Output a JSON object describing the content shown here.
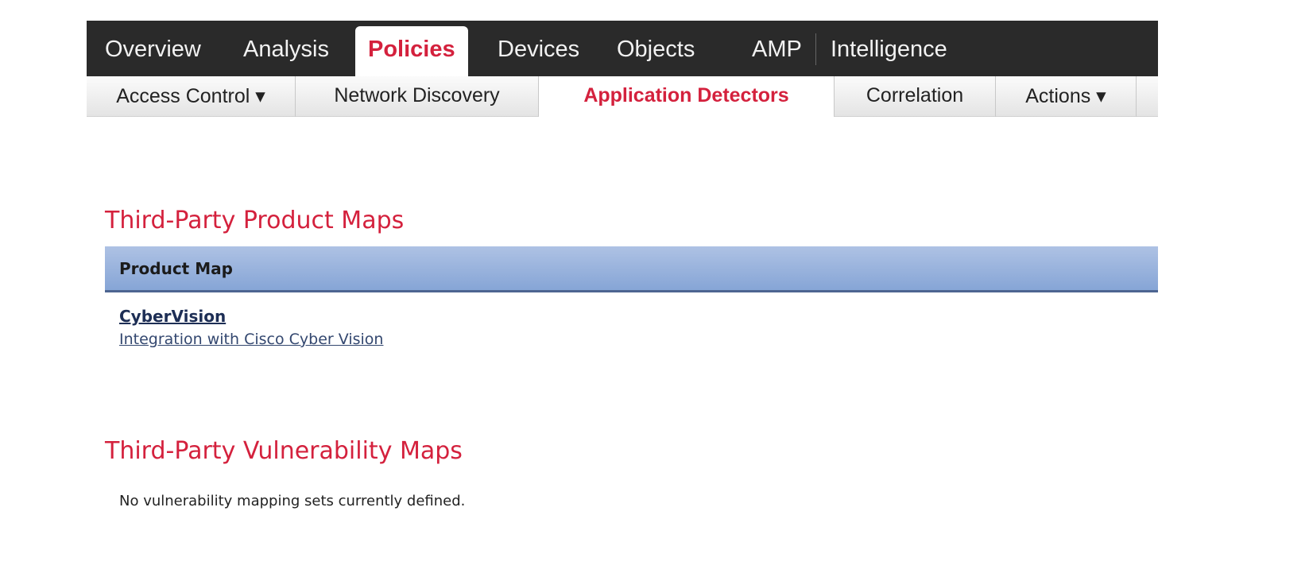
{
  "top_nav": {
    "items": [
      "Overview",
      "Analysis",
      "Policies",
      "Devices",
      "Objects",
      "AMP",
      "Intelligence"
    ],
    "active": "Policies"
  },
  "sub_nav": {
    "items": [
      "Access Control ▾",
      "Network Discovery",
      "Application Detectors",
      "Correlation",
      "Actions ▾"
    ],
    "active": "Application Detectors"
  },
  "product_maps": {
    "heading": "Third-Party Product Maps",
    "column": "Product Map",
    "rows": [
      {
        "name": "CyberVision",
        "description": "Integration with Cisco Cyber Vision"
      }
    ]
  },
  "vulnerability_maps": {
    "heading": "Third-Party Vulnerability Maps",
    "empty_message": "No vulnerability mapping sets currently defined."
  },
  "colors": {
    "accent": "#d4213d",
    "topbar": "#2a2a2a",
    "table_header": "#9db4de"
  }
}
